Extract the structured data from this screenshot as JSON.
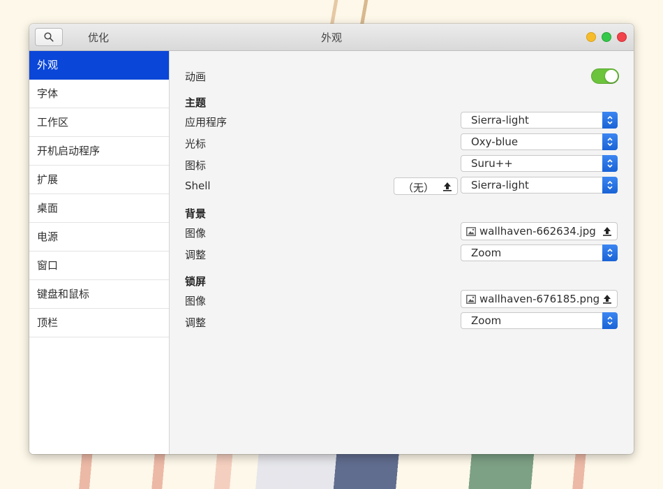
{
  "window": {
    "app_title": "优化",
    "page_title": "外观"
  },
  "sidebar": {
    "items": [
      {
        "label": "外观",
        "active": true
      },
      {
        "label": "字体"
      },
      {
        "label": "工作区"
      },
      {
        "label": "开机启动程序"
      },
      {
        "label": "扩展"
      },
      {
        "label": "桌面"
      },
      {
        "label": "电源"
      },
      {
        "label": "窗口"
      },
      {
        "label": "键盘和鼠标"
      },
      {
        "label": "顶栏"
      }
    ]
  },
  "appearance": {
    "animation": {
      "label": "动画",
      "enabled": true
    },
    "themes": {
      "heading": "主题",
      "applications": {
        "label": "应用程序",
        "value": "Sierra-light"
      },
      "cursor": {
        "label": "光标",
        "value": "Oxy-blue"
      },
      "icons": {
        "label": "图标",
        "value": "Suru++"
      },
      "shell": {
        "label": "Shell",
        "none_label": "（无）",
        "value": "Sierra-light"
      }
    },
    "background": {
      "heading": "背景",
      "image": {
        "label": "图像",
        "value": "wallhaven-662634.jpg"
      },
      "adjustment": {
        "label": "调整",
        "value": "Zoom"
      }
    },
    "lock_screen": {
      "heading": "锁屏",
      "image": {
        "label": "图像",
        "value": "wallhaven-676185.png"
      },
      "adjustment": {
        "label": "调整",
        "value": "Zoom"
      }
    }
  },
  "colors": {
    "accent": "#0a46d8",
    "toggle_on": "#6cc33c",
    "select_button": "#2a74e6"
  }
}
